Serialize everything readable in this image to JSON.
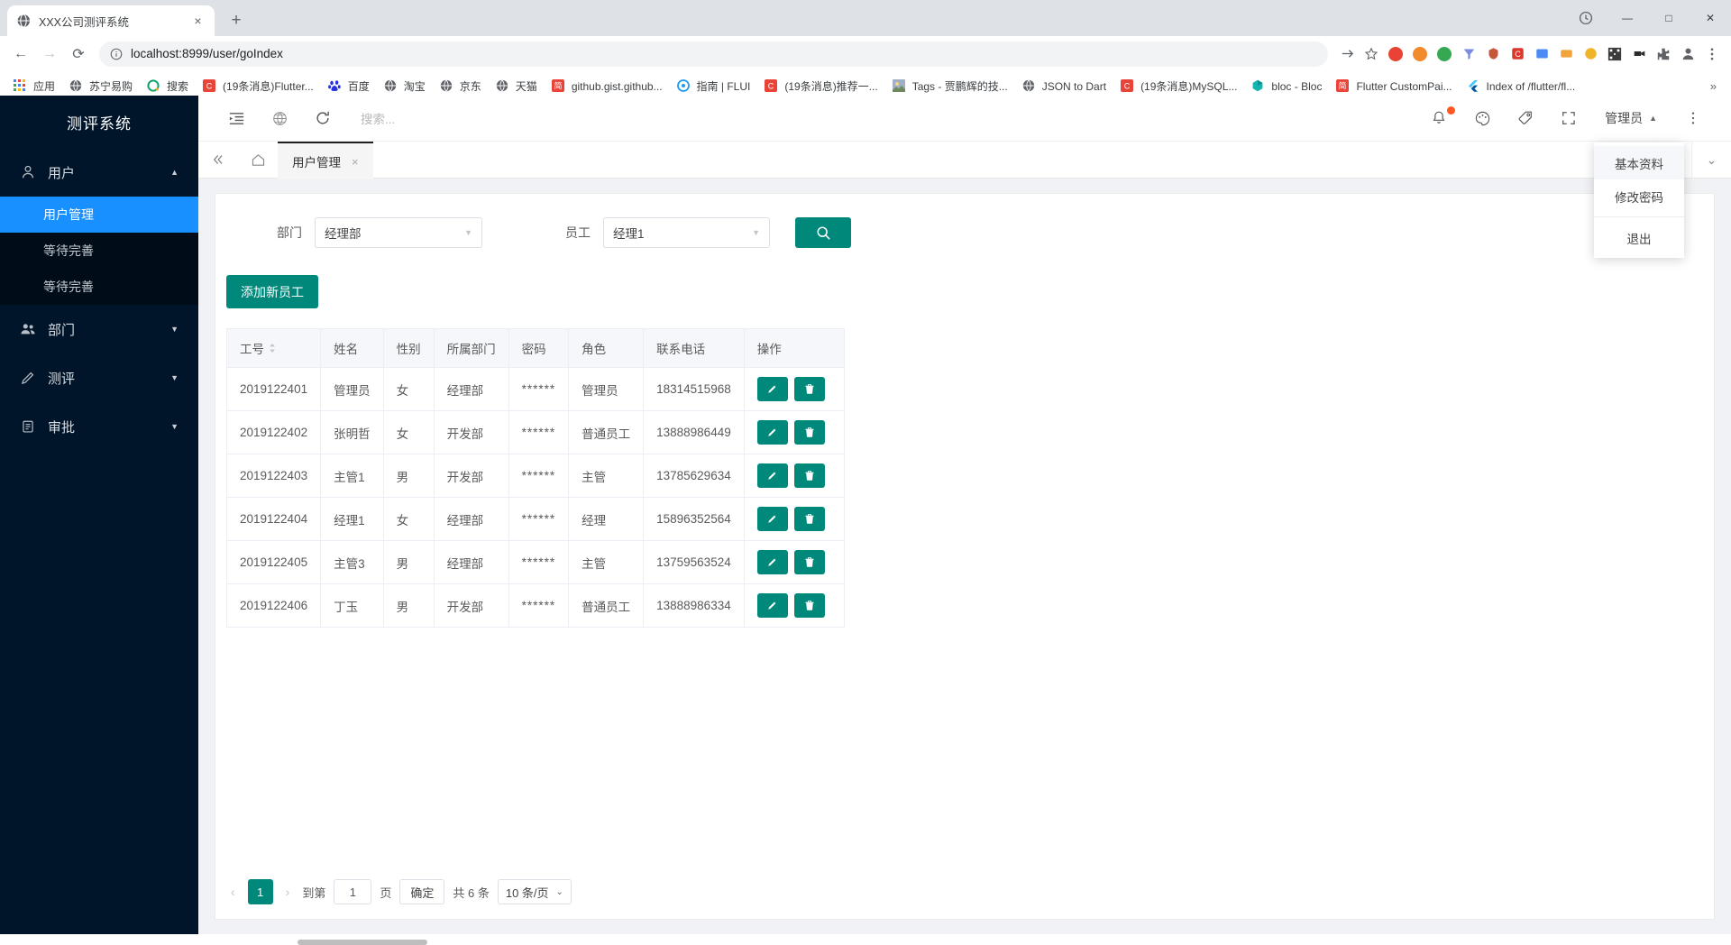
{
  "browser": {
    "tab": {
      "title": "XXX公司测评系统",
      "favicon": "globe-icon",
      "close": "×"
    },
    "new_tab_label": "+",
    "window_controls": {
      "minimize": "—",
      "maximize": "□",
      "close": "✕"
    },
    "nav": {
      "back": "←",
      "forward": "→",
      "reload": "⟳"
    },
    "omnibox": {
      "info_icon": "info-icon",
      "url": "localhost:8999/user/goIndex"
    },
    "bookmarks": [
      {
        "label": "应用",
        "icon": "apps-grid-icon"
      },
      {
        "label": "苏宁易购",
        "icon": "globe-icon"
      },
      {
        "label": "搜索",
        "icon": "search-circle-icon"
      },
      {
        "label": "(19条消息)Flutter...",
        "icon": "csdn-icon"
      },
      {
        "label": "百度",
        "icon": "baidu-icon"
      },
      {
        "label": "淘宝",
        "icon": "globe-icon"
      },
      {
        "label": "京东",
        "icon": "globe-icon"
      },
      {
        "label": "天猫",
        "icon": "globe-icon"
      },
      {
        "label": "github.gist.github...",
        "icon": "jian-icon"
      },
      {
        "label": "指南 | FLUI",
        "icon": "flui-icon"
      },
      {
        "label": "(19条消息)推荐一...",
        "icon": "csdn-icon"
      },
      {
        "label": "Tags - 贾鹏辉的技...",
        "icon": "photo-icon"
      },
      {
        "label": "JSON to Dart",
        "icon": "globe-icon"
      },
      {
        "label": "(19条消息)MySQL...",
        "icon": "csdn-icon"
      },
      {
        "label": "bloc - Bloc",
        "icon": "bloc-icon"
      },
      {
        "label": "Flutter CustomPai...",
        "icon": "jian-icon"
      },
      {
        "label": "Index of /flutter/fl...",
        "icon": "flutter-icon"
      }
    ],
    "bookmarks_overflow": "»"
  },
  "sidebar": {
    "logo": "测评系统",
    "groups": [
      {
        "label": "用户",
        "icon": "user-icon",
        "arrow": "▲",
        "expanded": true,
        "items": [
          {
            "label": "用户管理",
            "active": true
          },
          {
            "label": "等待完善",
            "active": false
          },
          {
            "label": "等待完善",
            "active": false
          }
        ]
      },
      {
        "label": "部门",
        "icon": "users-icon",
        "arrow": "▼",
        "expanded": false,
        "items": []
      },
      {
        "label": "测评",
        "icon": "pencil-icon",
        "arrow": "▼",
        "expanded": false,
        "items": []
      },
      {
        "label": "审批",
        "icon": "clipboard-icon",
        "arrow": "▼",
        "expanded": false,
        "items": []
      }
    ]
  },
  "topbar": {
    "menu_fold_icon": "menu-fold-icon",
    "globe_icon": "globe-icon",
    "refresh_icon": "refresh-icon",
    "search_placeholder": "搜索...",
    "bell_icon": "bell-icon",
    "theme_icon": "palette-icon",
    "tag_icon": "tag-icon",
    "fullscreen_icon": "fullscreen-icon",
    "user_name": "管理员",
    "user_arrow": "▲",
    "more_icon": "more-vertical-icon"
  },
  "user_menu": {
    "items": [
      {
        "label": "基本资料",
        "highlight": true
      },
      {
        "label": "修改密码",
        "highlight": false
      }
    ],
    "logout": "退出"
  },
  "tabbar": {
    "collapse_icon": "double-chevron-left-icon",
    "home_icon": "home-icon",
    "tabs": [
      {
        "label": "用户管理",
        "active": true,
        "close": "×"
      }
    ],
    "right_more": "»",
    "right_chevron": "⌄"
  },
  "filters": {
    "department": {
      "label": "部门",
      "value": "经理部",
      "caret": "▼"
    },
    "employee": {
      "label": "员工",
      "value": "经理1",
      "caret": "▼"
    },
    "search_button_icon": "search-icon"
  },
  "actions": {
    "add_employee": "添加新员工"
  },
  "table": {
    "columns": [
      "工号",
      "姓名",
      "性别",
      "所属部门",
      "密码",
      "角色",
      "联系电话",
      "操作"
    ],
    "sortable_column": "工号",
    "rows": [
      {
        "id": "2019122401",
        "name": "管理员",
        "gender": "女",
        "dept": "经理部",
        "password": "******",
        "role": "管理员",
        "phone": "18314515968"
      },
      {
        "id": "2019122402",
        "name": "张明哲",
        "gender": "女",
        "dept": "开发部",
        "password": "******",
        "role": "普通员工",
        "phone": "13888986449"
      },
      {
        "id": "2019122403",
        "name": "主管1",
        "gender": "男",
        "dept": "开发部",
        "password": "******",
        "role": "主管",
        "phone": "13785629634"
      },
      {
        "id": "2019122404",
        "name": "经理1",
        "gender": "女",
        "dept": "经理部",
        "password": "******",
        "role": "经理",
        "phone": "15896352564"
      },
      {
        "id": "2019122405",
        "name": "主管3",
        "gender": "男",
        "dept": "经理部",
        "password": "******",
        "role": "主管",
        "phone": "13759563524"
      },
      {
        "id": "2019122406",
        "name": "丁玉",
        "gender": "男",
        "dept": "开发部",
        "password": "******",
        "role": "普通员工",
        "phone": "13888986334"
      }
    ],
    "row_actions": {
      "edit_icon": "pencil-icon",
      "delete_icon": "trash-icon"
    }
  },
  "pagination": {
    "prev": "‹",
    "next": "›",
    "current_page": "1",
    "goto_label": "到第",
    "goto_value": "1",
    "page_unit": "页",
    "confirm": "确定",
    "total_text": "共 6 条",
    "page_size": "10 条/页",
    "page_size_caret": "⌄"
  },
  "colors": {
    "primary_teal": "#00897b",
    "sidebar_bg": "#001529",
    "active_blue": "#1890ff",
    "badge_orange": "#ff5722"
  }
}
